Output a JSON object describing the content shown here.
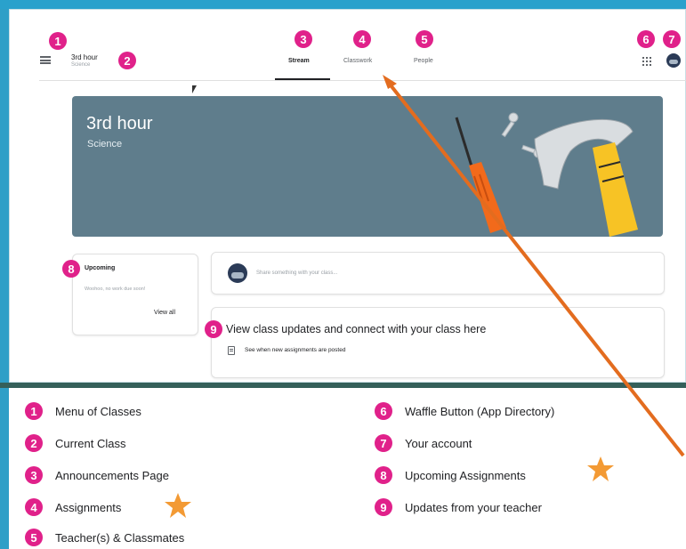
{
  "class": {
    "title": "3rd hour",
    "subtitle": "Science"
  },
  "tabs": [
    {
      "label": "Stream",
      "active": true
    },
    {
      "label": "Classwork",
      "active": false
    },
    {
      "label": "People",
      "active": false
    }
  ],
  "banner": {
    "title": "3rd hour",
    "subtitle": "Science"
  },
  "upcoming": {
    "title": "Upcoming",
    "empty_text": "Woohoo, no work due soon!",
    "view_all": "View all"
  },
  "share": {
    "placeholder": "Share something with your class..."
  },
  "updates": {
    "title": "View class updates and connect with your class here",
    "subtitle": "See when new assignments are posted"
  },
  "badges": [
    "1",
    "2",
    "3",
    "4",
    "5",
    "6",
    "7",
    "8",
    "9"
  ],
  "legend": [
    {
      "num": "1",
      "text": "Menu of Classes"
    },
    {
      "num": "2",
      "text": "Current Class"
    },
    {
      "num": "3",
      "text": "Announcements Page"
    },
    {
      "num": "4",
      "text": "Assignments"
    },
    {
      "num": "5",
      "text": "Teacher(s) & Classmates"
    },
    {
      "num": "6",
      "text": "Waffle Button (App Directory)"
    },
    {
      "num": "7",
      "text": "Your account"
    },
    {
      "num": "8",
      "text": "Upcoming Assignments"
    },
    {
      "num": "9",
      "text": "Updates from your teacher"
    }
  ],
  "colors": {
    "badge": "#e0218a",
    "banner": "#5f7d8c",
    "arrow": "#e36c1f",
    "star": "#f39a34",
    "frame": "#2f9fc7"
  },
  "icons": [
    "menu-icon",
    "waffle-icon",
    "account-avatar-icon",
    "assignment-icon",
    "star-icon",
    "screwdriver-icon",
    "hammer-icon"
  ]
}
